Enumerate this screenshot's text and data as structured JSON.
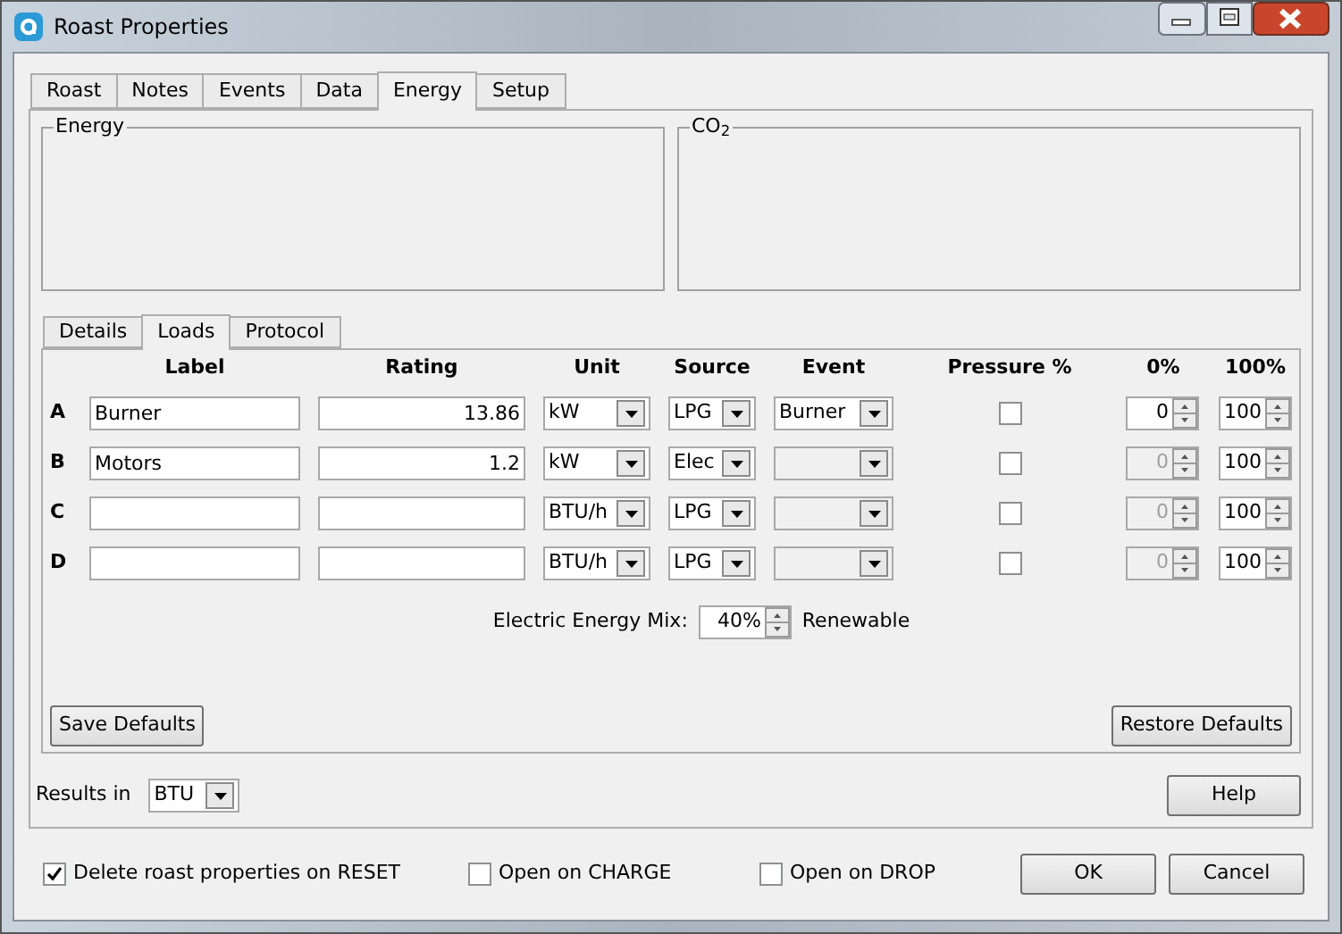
{
  "window": {
    "title": "Roast Properties"
  },
  "tabs": [
    {
      "label": "Roast",
      "selected": false
    },
    {
      "label": "Notes",
      "selected": false
    },
    {
      "label": "Events",
      "selected": false
    },
    {
      "label": "Data",
      "selected": false
    },
    {
      "label": "Energy",
      "selected": true
    },
    {
      "label": "Setup",
      "selected": false
    }
  ],
  "groups": [
    {
      "title": "Energy"
    },
    {
      "title": "CO$_{2}$"
    }
  ],
  "subtabs": [
    {
      "label": "Details",
      "selected": false
    },
    {
      "label": "Loads",
      "selected": true
    },
    {
      "label": "Protocol",
      "selected": false
    }
  ],
  "columns": [
    "Label",
    "Rating",
    "Unit",
    "Source",
    "Event",
    "Pressure %",
    "0%",
    "100%"
  ],
  "loads": [
    {
      "letter": "A",
      "label": "Burner",
      "rating": "13.86",
      "unit": "kW",
      "source": "LPG",
      "event": "Burner",
      "event_disabled": false,
      "pressure": false,
      "zero": "0",
      "zero_disabled": false,
      "full": "100"
    },
    {
      "letter": "B",
      "label": "Motors",
      "rating": "1.2",
      "unit": "kW",
      "source": "Elec",
      "event_disabled": true,
      "pressure": false,
      "zero": "0",
      "zero_disabled": true,
      "full": "100"
    },
    {
      "letter": "C",
      "unit": "BTU/h",
      "source": "LPG",
      "event_disabled": true,
      "pressure": false,
      "zero": "0",
      "zero_disabled": true,
      "full": "100"
    },
    {
      "letter": "D",
      "unit": "BTU/h",
      "source": "LPG",
      "event_disabled": true,
      "pressure": false,
      "zero": "0",
      "zero_disabled": true,
      "full": "100"
    }
  ],
  "mix": {
    "label": "Electric Energy Mix:",
    "value": "40%",
    "suffix": "Renewable"
  },
  "save_defaults": "Save Defaults",
  "restore_defaults": "Restore Defaults",
  "results": {
    "label": "Results in",
    "value": "BTU"
  },
  "help": "Help",
  "options": [
    {
      "label": "Delete roast properties on RESET",
      "checked": true
    },
    {
      "label": "Open on CHARGE",
      "checked": false
    },
    {
      "label": "Open on DROP",
      "checked": false
    }
  ],
  "buttons": [
    "OK",
    "Cancel"
  ]
}
